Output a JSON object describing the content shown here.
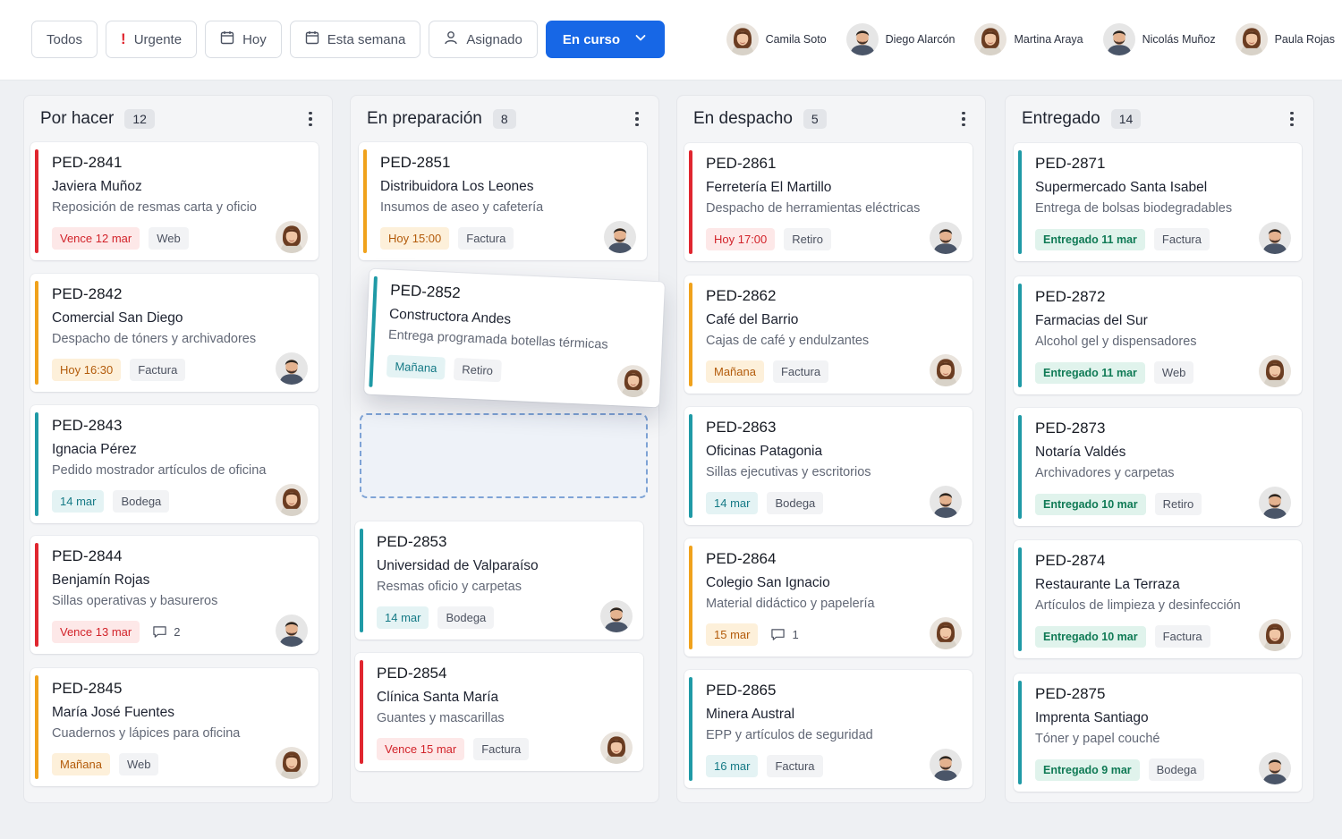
{
  "filters": [
    {
      "label": "Todos",
      "icon": "none"
    },
    {
      "label": "Urgente",
      "icon": "exclamation-icon"
    },
    {
      "label": "Hoy",
      "icon": "calendar-icon"
    },
    {
      "label": "Esta semana",
      "icon": "calendar-icon"
    },
    {
      "label": "Asignado",
      "icon": "user-icon"
    },
    {
      "label": "En curso",
      "icon": "chevron-down-icon",
      "active": true
    }
  ],
  "people": [
    {
      "name": "Camila Soto"
    },
    {
      "name": "Diego Alarcón"
    },
    {
      "name": "Martina Araya"
    },
    {
      "name": "Nicolás Muñoz"
    },
    {
      "name": "Paula Rojas"
    }
  ],
  "colors": {
    "accent_blue": "#1767e6",
    "red": "#e0262f",
    "orange": "#f0a21c",
    "teal": "#1f9aa6"
  },
  "columns": [
    {
      "title": "Por hacer",
      "count": "12",
      "cards": [
        {
          "id": "PED-2841",
          "name": "Javiera Muñoz",
          "desc": "Reposición de resmas carta y oficio",
          "tag1": "Vence 12 mar",
          "tag2": "Web"
        },
        {
          "id": "PED-2842",
          "name": "Comercial San Diego",
          "desc": "Despacho de tóners y archivadores",
          "tag1": "Hoy 16:30",
          "tag2": "Factura"
        },
        {
          "id": "PED-2843",
          "name": "Ignacia Pérez",
          "desc": "Pedido mostrador artículos de oficina",
          "tag1": "14 mar",
          "tag2": "Bodega"
        },
        {
          "id": "PED-2844",
          "name": "Benjamín Rojas",
          "desc": "Sillas operativas y basureros",
          "tag1": "Vence 13 mar",
          "tag2": "2"
        },
        {
          "id": "PED-2845",
          "name": "María José Fuentes",
          "desc": "Cuadernos y lápices para oficina",
          "tag1": "Mañana",
          "tag2": "Web"
        }
      ]
    },
    {
      "title": "En preparación",
      "count": "8",
      "cards": [
        {
          "id": "PED-2851",
          "name": "Distribuidora Los Leones",
          "desc": "Insumos de aseo y cafetería",
          "tag1": "Hoy 15:00",
          "tag2": "Factura"
        },
        {
          "id": "PED-2852",
          "name": "Constructora Andes",
          "desc": "Entrega programada botellas térmicas",
          "tag1": "Mañana",
          "tag2": "Retiro"
        },
        {
          "id": "PED-2853",
          "name": "Universidad de Valparaíso",
          "desc": "Resmas oficio y carpetas",
          "tag1": "14 mar",
          "tag2": "Bodega"
        },
        {
          "id": "PED-2854",
          "name": "Clínica Santa María",
          "desc": "Guantes y mascarillas",
          "tag1": "Vence 15 mar",
          "tag2": "Factura"
        }
      ]
    },
    {
      "title": "En despacho",
      "count": "5",
      "cards": [
        {
          "id": "PED-2861",
          "name": "Ferretería El Martillo",
          "desc": "Despacho de herramientas eléctricas",
          "tag1": "Hoy 17:00",
          "tag2": "Retiro"
        },
        {
          "id": "PED-2862",
          "name": "Café del Barrio",
          "desc": "Cajas de café y endulzantes",
          "tag1": "Mañana",
          "tag2": "Factura"
        },
        {
          "id": "PED-2863",
          "name": "Oficinas Patagonia",
          "desc": "Sillas ejecutivas y escritorios",
          "tag1": "14 mar",
          "tag2": "Bodega"
        },
        {
          "id": "PED-2864",
          "name": "Colegio San Ignacio",
          "desc": "Material didáctico y papelería",
          "tag1": "15 mar",
          "tag2": "1"
        },
        {
          "id": "PED-2865",
          "name": "Minera Austral",
          "desc": "EPP y artículos de seguridad",
          "tag1": "16 mar",
          "tag2": "Factura"
        }
      ]
    },
    {
      "title": "Entregado",
      "count": "14",
      "cards": [
        {
          "id": "PED-2871",
          "name": "Supermercado Santa Isabel",
          "desc": "Entrega de bolsas biodegradables",
          "tag1": "Entregado 11 mar",
          "tag2": "Factura"
        },
        {
          "id": "PED-2872",
          "name": "Farmacias del Sur",
          "desc": "Alcohol gel y dispensadores",
          "tag1": "Entregado 11 mar",
          "tag2": "Web"
        },
        {
          "id": "PED-2873",
          "name": "Notaría Valdés",
          "desc": "Archivadores y carpetas",
          "tag1": "Entregado 10 mar",
          "tag2": "Retiro"
        },
        {
          "id": "PED-2874",
          "name": "Restaurante La Terraza",
          "desc": "Artículos de limpieza y desinfección",
          "tag1": "Entregado 10 mar",
          "tag2": "Factura"
        },
        {
          "id": "PED-2875",
          "name": "Imprenta Santiago",
          "desc": "Tóner y papel couché",
          "tag1": "Entregado 9 mar",
          "tag2": "Bodega"
        }
      ]
    }
  ]
}
